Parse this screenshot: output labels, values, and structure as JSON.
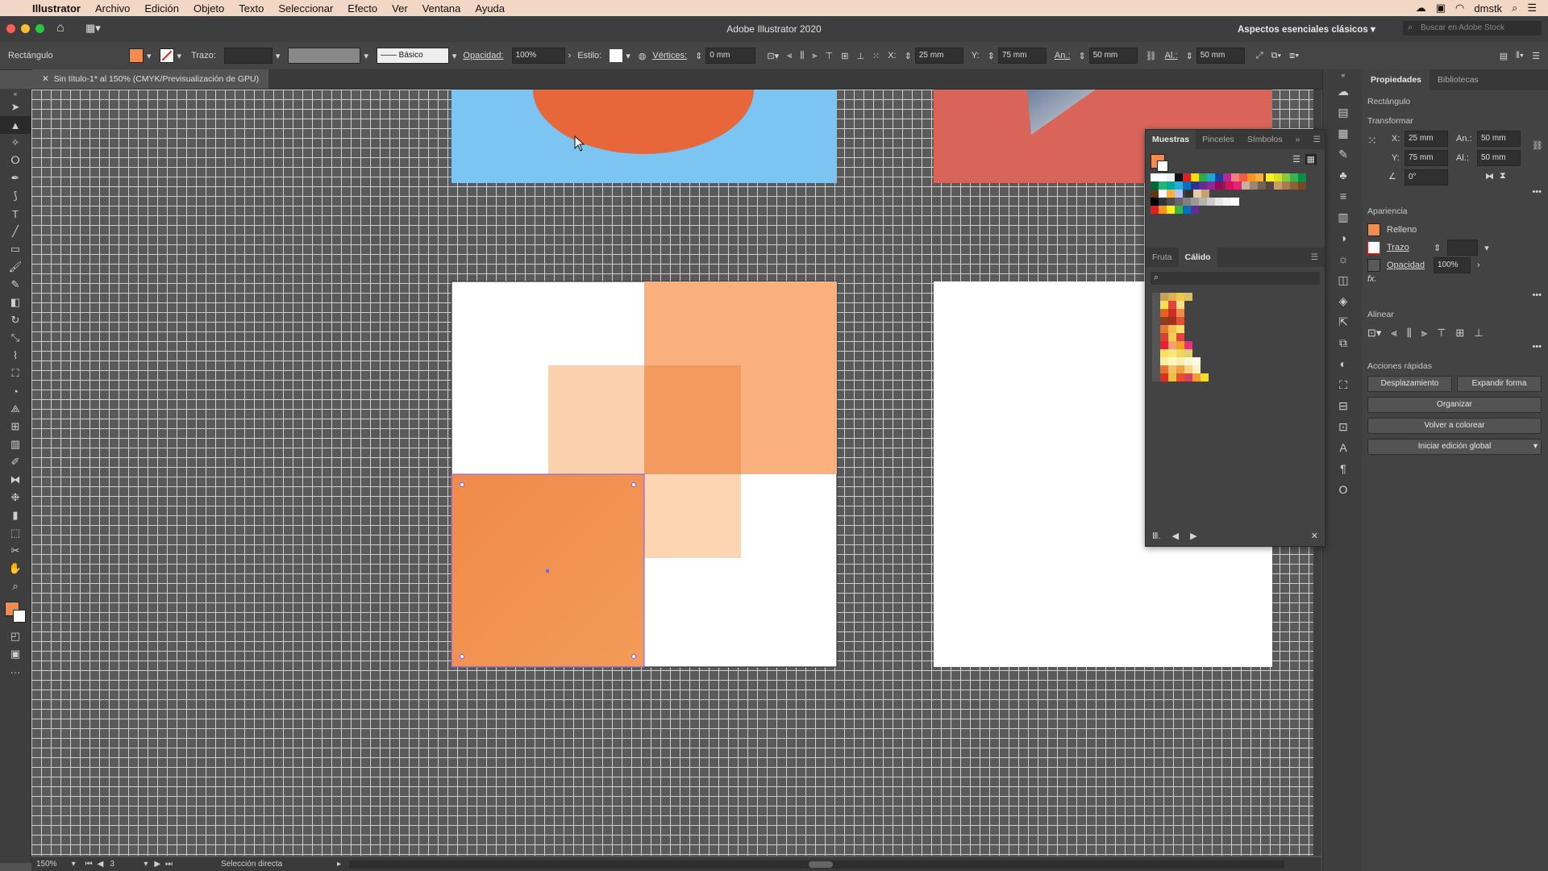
{
  "menubar": {
    "app": "Illustrator",
    "items": [
      "Archivo",
      "Edición",
      "Objeto",
      "Texto",
      "Seleccionar",
      "Efecto",
      "Ver",
      "Ventana",
      "Ayuda"
    ],
    "user": "dmstk"
  },
  "titlebar": {
    "title": "Adobe Illustrator 2020",
    "workspace": "Aspectos esenciales clásicos",
    "search_placeholder": "Buscar en Adobe Stock"
  },
  "controlbar": {
    "object_type": "Rectángulo",
    "stroke_label": "Trazo:",
    "stroke_style": "Básico",
    "opacity_label": "Opacidad:",
    "opacity_value": "100%",
    "style_label": "Estilo:",
    "vertices_label": "Vértices:",
    "vertices_value": "0 mm",
    "x_label": "X:",
    "x_value": "25 mm",
    "y_label": "Y:",
    "y_value": "75 mm",
    "w_label": "An.:",
    "w_value": "50 mm",
    "h_label": "Al.:",
    "h_value": "50 mm"
  },
  "document": {
    "tab_title": "Sin título-1* al 150% (CMYK/Previsualización de GPU)"
  },
  "statusbar": {
    "zoom": "150%",
    "artboard": "3",
    "tool": "Selección directa"
  },
  "properties_panel": {
    "tabs": [
      "Propiedades",
      "Bibliotecas"
    ],
    "object_type": "Rectángulo",
    "transform_header": "Transformar",
    "x_label": "X:",
    "x_value": "25 mm",
    "y_label": "Y:",
    "y_value": "75 mm",
    "w_label": "An.:",
    "w_value": "50 mm",
    "h_label": "Al.:",
    "h_value": "50 mm",
    "rotation_value": "0°",
    "appearance_header": "Apariencia",
    "fill_label": "Relleno",
    "stroke_label": "Trazo",
    "opacity_label": "Opacidad",
    "opacity_value": "100%",
    "fx_label": "fx.",
    "align_header": "Alinear",
    "quick_actions_header": "Acciones rápidas",
    "btn_offset": "Desplazamiento",
    "btn_expand": "Expandir forma",
    "btn_arrange": "Organizar",
    "btn_recolor": "Volver a colorear",
    "btn_global_edit": "Iniciar edición global"
  },
  "swatches_panel": {
    "tabs": [
      "Muestras",
      "Pinceles",
      "Símbolos"
    ],
    "sub_tabs": [
      "Fruta",
      "Cálido"
    ]
  },
  "colors": {
    "fill": "#f28c4c",
    "canvas_blue": "#7cc4f2",
    "canvas_red": "#d9645a",
    "orange_circle": "#e8673a"
  }
}
